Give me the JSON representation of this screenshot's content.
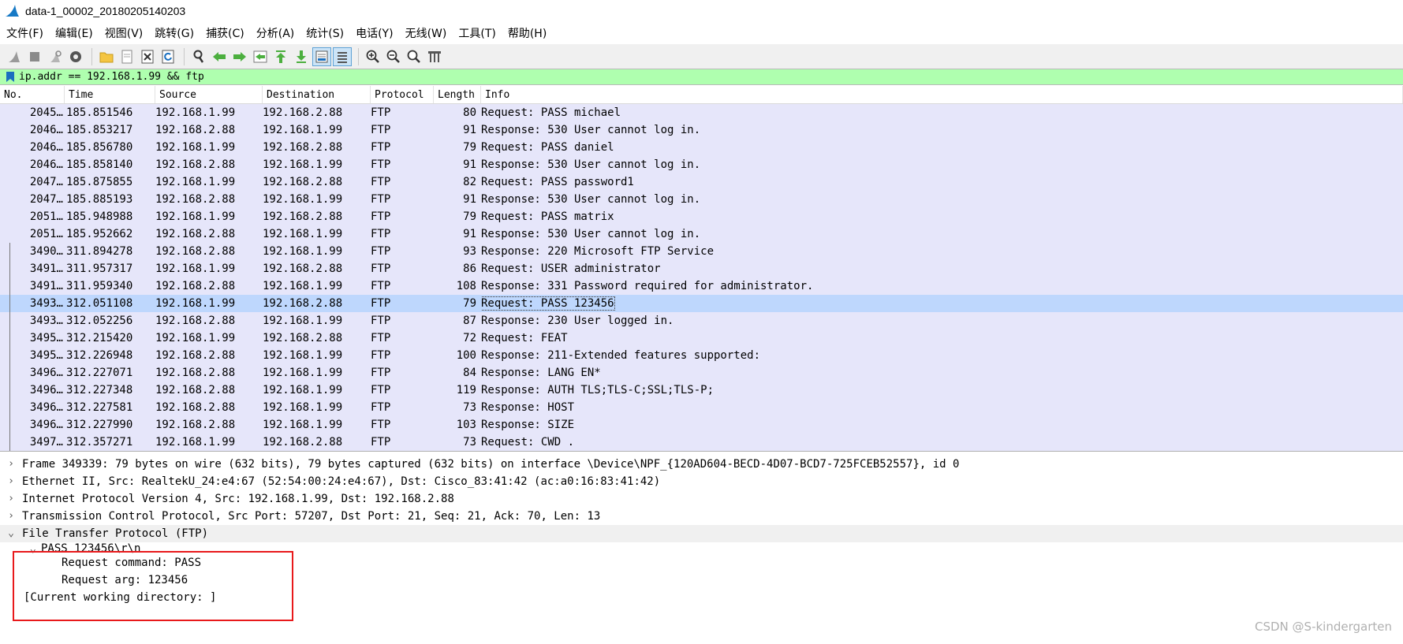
{
  "window": {
    "title": "data-1_00002_20180205140203"
  },
  "menu": [
    "文件(F)",
    "编辑(E)",
    "视图(V)",
    "跳转(G)",
    "捕获(C)",
    "分析(A)",
    "统计(S)",
    "电话(Y)",
    "无线(W)",
    "工具(T)",
    "帮助(H)"
  ],
  "filter": {
    "value": "ip.addr == 192.168.1.99 && ftp"
  },
  "columns": [
    "No.",
    "Time",
    "Source",
    "Destination",
    "Protocol",
    "Length",
    "Info"
  ],
  "packets": [
    {
      "no": "2045…",
      "time": "185.851546",
      "src": "192.168.1.99",
      "dst": "192.168.2.88",
      "proto": "FTP",
      "len": "80",
      "info": "Request: PASS michael"
    },
    {
      "no": "2046…",
      "time": "185.853217",
      "src": "192.168.2.88",
      "dst": "192.168.1.99",
      "proto": "FTP",
      "len": "91",
      "info": "Response: 530 User cannot log in."
    },
    {
      "no": "2046…",
      "time": "185.856780",
      "src": "192.168.1.99",
      "dst": "192.168.2.88",
      "proto": "FTP",
      "len": "79",
      "info": "Request: PASS daniel"
    },
    {
      "no": "2046…",
      "time": "185.858140",
      "src": "192.168.2.88",
      "dst": "192.168.1.99",
      "proto": "FTP",
      "len": "91",
      "info": "Response: 530 User cannot log in."
    },
    {
      "no": "2047…",
      "time": "185.875855",
      "src": "192.168.1.99",
      "dst": "192.168.2.88",
      "proto": "FTP",
      "len": "82",
      "info": "Request: PASS password1"
    },
    {
      "no": "2047…",
      "time": "185.885193",
      "src": "192.168.2.88",
      "dst": "192.168.1.99",
      "proto": "FTP",
      "len": "91",
      "info": "Response: 530 User cannot log in."
    },
    {
      "no": "2051…",
      "time": "185.948988",
      "src": "192.168.1.99",
      "dst": "192.168.2.88",
      "proto": "FTP",
      "len": "79",
      "info": "Request: PASS matrix"
    },
    {
      "no": "2051…",
      "time": "185.952662",
      "src": "192.168.2.88",
      "dst": "192.168.1.99",
      "proto": "FTP",
      "len": "91",
      "info": "Response: 530 User cannot log in."
    },
    {
      "no": "3490…",
      "time": "311.894278",
      "src": "192.168.2.88",
      "dst": "192.168.1.99",
      "proto": "FTP",
      "len": "93",
      "info": "Response: 220 Microsoft FTP Service"
    },
    {
      "no": "3491…",
      "time": "311.957317",
      "src": "192.168.1.99",
      "dst": "192.168.2.88",
      "proto": "FTP",
      "len": "86",
      "info": "Request: USER administrator"
    },
    {
      "no": "3491…",
      "time": "311.959340",
      "src": "192.168.2.88",
      "dst": "192.168.1.99",
      "proto": "FTP",
      "len": "108",
      "info": "Response: 331 Password required for administrator."
    },
    {
      "no": "3493…",
      "time": "312.051108",
      "src": "192.168.1.99",
      "dst": "192.168.2.88",
      "proto": "FTP",
      "len": "79",
      "info": "Request: PASS 123456"
    },
    {
      "no": "3493…",
      "time": "312.052256",
      "src": "192.168.2.88",
      "dst": "192.168.1.99",
      "proto": "FTP",
      "len": "87",
      "info": "Response: 230 User logged in."
    },
    {
      "no": "3495…",
      "time": "312.215420",
      "src": "192.168.1.99",
      "dst": "192.168.2.88",
      "proto": "FTP",
      "len": "72",
      "info": "Request: FEAT"
    },
    {
      "no": "3495…",
      "time": "312.226948",
      "src": "192.168.2.88",
      "dst": "192.168.1.99",
      "proto": "FTP",
      "len": "100",
      "info": "Response: 211-Extended features supported:"
    },
    {
      "no": "3496…",
      "time": "312.227071",
      "src": "192.168.2.88",
      "dst": "192.168.1.99",
      "proto": "FTP",
      "len": "84",
      "info": "Response:  LANG EN*"
    },
    {
      "no": "3496…",
      "time": "312.227348",
      "src": "192.168.2.88",
      "dst": "192.168.1.99",
      "proto": "FTP",
      "len": "119",
      "info": "Response:  AUTH TLS;TLS-C;SSL;TLS-P;"
    },
    {
      "no": "3496…",
      "time": "312.227581",
      "src": "192.168.2.88",
      "dst": "192.168.1.99",
      "proto": "FTP",
      "len": "73",
      "info": "Response:  HOST"
    },
    {
      "no": "3496…",
      "time": "312.227990",
      "src": "192.168.2.88",
      "dst": "192.168.1.99",
      "proto": "FTP",
      "len": "103",
      "info": "Response:  SIZE"
    },
    {
      "no": "3497…",
      "time": "312.357271",
      "src": "192.168.1.99",
      "dst": "192.168.2.88",
      "proto": "FTP",
      "len": "73",
      "info": "Request: CWD ."
    }
  ],
  "selected_index": 11,
  "details": {
    "frame": "Frame 349339: 79 bytes on wire (632 bits), 79 bytes captured (632 bits) on interface \\Device\\NPF_{120AD604-BECD-4D07-BCD7-725FCEB52557}, id 0",
    "ethernet": "Ethernet II, Src: RealtekU_24:e4:67 (52:54:00:24:e4:67), Dst: Cisco_83:41:42 (ac:a0:16:83:41:42)",
    "ip": "Internet Protocol Version 4, Src: 192.168.1.99, Dst: 192.168.2.88",
    "tcp": "Transmission Control Protocol, Src Port: 57207, Dst Port: 21, Seq: 21, Ack: 70, Len: 13",
    "ftp": "File Transfer Protocol (FTP)",
    "pass_line": "PASS 123456\\r\\n",
    "req_cmd": "Request command: PASS",
    "req_arg": "Request arg: 123456",
    "cwd": "[Current working directory: ]"
  },
  "watermark": "CSDN @S-kindergarten",
  "colors": {
    "row_bg": "#e6e6fa",
    "selected_bg": "#bed7fd",
    "filter_bg": "#afffaf",
    "highlight_box": "#e8191b"
  }
}
